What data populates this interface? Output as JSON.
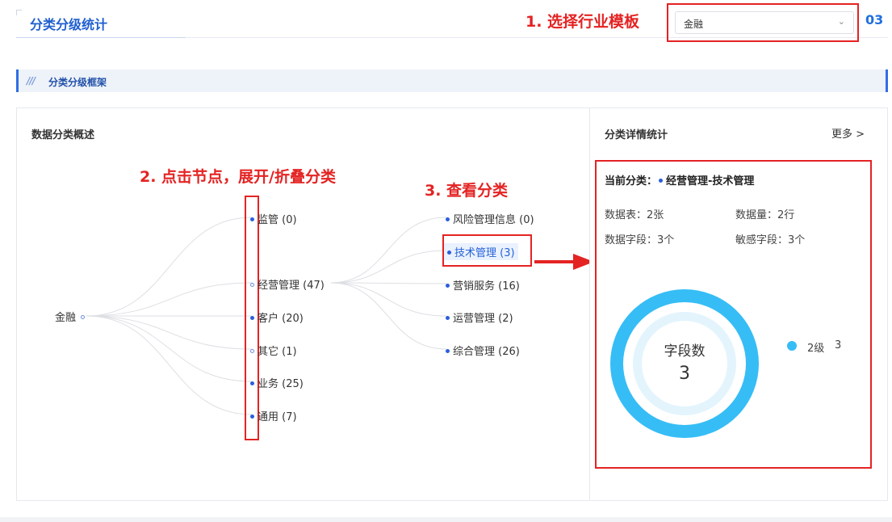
{
  "header": {
    "title": "分类分级统计",
    "industry_select_value": "金融",
    "page_number": "03"
  },
  "annotations": {
    "step1": "1. 选择行业模板",
    "step2": "2. 点击节点，展开/折叠分类",
    "step3": "3. 查看分类"
  },
  "section": {
    "slashes": "///",
    "title": "分类分级框架"
  },
  "overview": {
    "title": "数据分类概述",
    "root": "金融",
    "level1": [
      {
        "label": "监管 (0)"
      },
      {
        "label": "经营管理 (47)"
      },
      {
        "label": "客户 (20)"
      },
      {
        "label": "其它 (1)"
      },
      {
        "label": "业务 (25)"
      },
      {
        "label": "通用 (7)"
      }
    ],
    "level2": [
      {
        "label": "风险管理信息 (0)"
      },
      {
        "label": "技术管理 (3)"
      },
      {
        "label": "营销服务 (16)"
      },
      {
        "label": "运营管理 (2)"
      },
      {
        "label": "综合管理 (26)"
      }
    ]
  },
  "details": {
    "title": "分类详情统计",
    "more": "更多 >",
    "current_label": "当前分类：",
    "current_value": "经营管理-技术管理",
    "tables": "数据表：2张",
    "volume": "数据量：2行",
    "fields": "数据字段：3个",
    "sensitive": "敏感字段：3个",
    "donut_label": "字段数",
    "donut_value": "3",
    "legend_name": "2级",
    "legend_value": "3",
    "legend_color": "#36bdf6"
  }
}
